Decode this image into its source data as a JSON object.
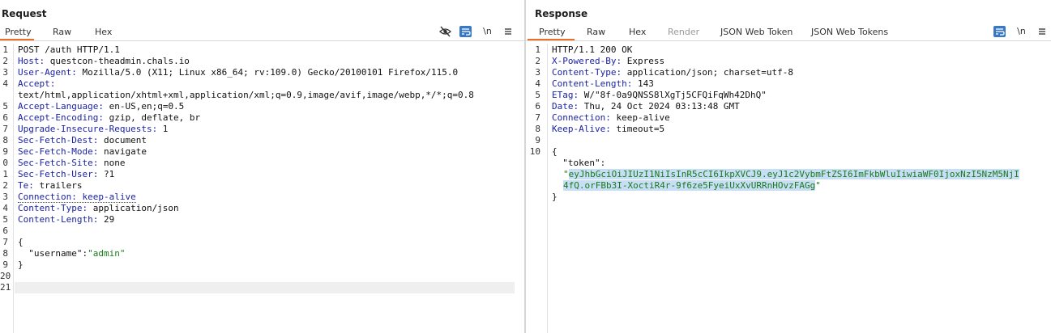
{
  "request": {
    "title": "Request",
    "tabs": [
      {
        "label": "Pretty",
        "active": true
      },
      {
        "label": "Raw",
        "active": false
      },
      {
        "label": "Hex",
        "active": false
      }
    ],
    "tools": {
      "hide_icon": "eye-off-icon",
      "wrap_icon": "wrap-lines-icon",
      "newline_label": "\\n",
      "menu_icon": "hamburger-menu-icon"
    },
    "lines": {
      "n": [
        "1",
        "2",
        "3",
        "4",
        "5",
        "6",
        "7",
        "8",
        "9",
        "0",
        "1",
        "2",
        "3",
        "4",
        "5",
        "6",
        "7",
        "8",
        "9",
        "20",
        "21"
      ],
      "l1": "POST /auth HTTP/1.1",
      "h2": "Host:",
      "v2": " questcon-theadmin.chals.io",
      "h3": "User-Agent:",
      "v3": " Mozilla/5.0 (X11; Linux x86_64; rv:109.0) Gecko/20100101 Firefox/115.0",
      "h4": "Accept:",
      "v4b": "text/html,application/xhtml+xml,application/xml;q=0.9,image/avif,image/webp,*/*;q=0.8",
      "h5": "Accept-Language:",
      "v5": " en-US,en;q=0.5",
      "h6": "Accept-Encoding:",
      "v6": " gzip, deflate, br",
      "h7": "Upgrade-Insecure-Requests:",
      "v7": " 1",
      "h8": "Sec-Fetch-Dest:",
      "v8": " document",
      "h9": "Sec-Fetch-Mode:",
      "v9": " navigate",
      "h10": "Sec-Fetch-Site:",
      "v10": " none",
      "h11": "Sec-Fetch-User:",
      "v11": " ?1",
      "h12": "Te:",
      "v12": " trailers",
      "h13": "Connection: keep-alive",
      "h14": "Content-Type:",
      "v14": " application/json",
      "h15": "Content-Length:",
      "v15": " 29",
      "l17": "{",
      "k18": "  \"username\"",
      "c18": ":",
      "s18": "\"admin\"",
      "l19": "}"
    }
  },
  "response": {
    "title": "Response",
    "tabs": [
      {
        "label": "Pretty",
        "active": true
      },
      {
        "label": "Raw",
        "active": false
      },
      {
        "label": "Hex",
        "active": false
      },
      {
        "label": "Render",
        "active": false,
        "disabled": true
      },
      {
        "label": "JSON Web Token",
        "active": false
      },
      {
        "label": "JSON Web Tokens",
        "active": false
      }
    ],
    "tools": {
      "wrap_icon": "wrap-lines-icon",
      "newline_label": "\\n",
      "menu_icon": "hamburger-menu-icon"
    },
    "lines": {
      "n": [
        "1",
        "2",
        "3",
        "4",
        "5",
        "6",
        "7",
        "8",
        "9",
        "10"
      ],
      "l1": "HTTP/1.1 200 OK",
      "h2": "X-Powered-By:",
      "v2": " Express",
      "h3": "Content-Type:",
      "v3": " application/json; charset=utf-8",
      "h4": "Content-Length:",
      "v4": " 143",
      "h5": "ETag:",
      "v5": " W/\"8f-0a9QNSS8lXgTj5CFQiFqWh42DhQ\"",
      "h6": "Date:",
      "v6": " Thu, 24 Oct 2024 03:13:48 GMT",
      "h7": "Connection:",
      "v7": " keep-alive",
      "h8": "Keep-Alive:",
      "v8": " timeout=5",
      "l10": "{",
      "k11": "  \"token\":",
      "q12": "\"",
      "s12": "eyJhbGciOiJIUzI1NiIsInR5cCI6IkpXVCJ9.eyJ1c2VybmFtZSI6ImFkbWluIiwiaWF0IjoxNzI5NzM5NjI",
      "s13": "4fQ.orFBb3I-XoctiR4r-9f6ze5FyeiUxXvURRnHOvzFAGg",
      "q13": "\"",
      "l14": "}"
    }
  },
  "colors": {
    "accent": "#e8702a",
    "header_name": "#1a22a8",
    "json_string": "#187c18",
    "selection": "#c8def6",
    "toggle_on": "#3a78c2"
  }
}
